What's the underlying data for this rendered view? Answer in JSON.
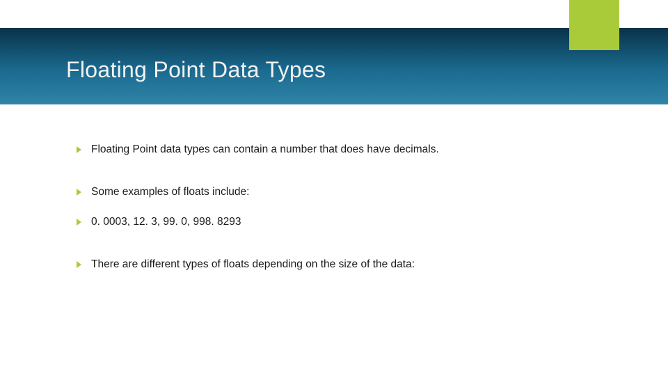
{
  "slide": {
    "title": "Floating Point Data Types",
    "accent_color": "#a9cb3a",
    "header_gradient": [
      "#083249",
      "#1b6a8f",
      "#2f84a8"
    ],
    "bullets": [
      {
        "text": "Floating Point data types can contain a number that does have decimals.",
        "gap": "large"
      },
      {
        "text": "Some examples of floats include:",
        "gap": "small"
      },
      {
        "text": "0. 0003, 12. 3, 99. 0, 998. 8293",
        "gap": "large"
      },
      {
        "text": "There are different types of floats depending on the size of the data:",
        "gap": "large"
      }
    ]
  }
}
